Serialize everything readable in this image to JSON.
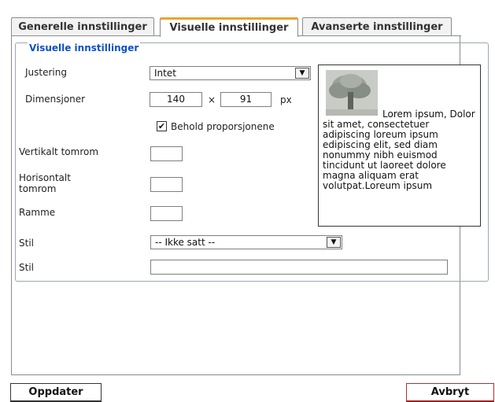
{
  "tabs": [
    {
      "label": "Generelle innstillinger",
      "active": false
    },
    {
      "label": "Visuelle innstillinger",
      "active": true
    },
    {
      "label": "Avanserte innstillinger",
      "active": false
    }
  ],
  "fieldset": {
    "legend": "Visuelle innstillinger"
  },
  "form": {
    "alignment_label": "Justering",
    "alignment_value": "Intet",
    "dimensions_label": "Dimensjoner",
    "width_value": "140",
    "times_sign": "×",
    "height_value": "91",
    "unit": "px",
    "keep_proportions_label": "Behold proporsjonene",
    "keep_proportions_checked": true,
    "vspace_label": "Vertikalt tomrom",
    "hspace_label_line1": "Horisontalt",
    "hspace_label_line2": "tomrom",
    "border_label": "Ramme",
    "style_select_label": "Stil",
    "style_select_value": "-- Ikke satt --",
    "style_text_label": "Stil",
    "style_text_value": ""
  },
  "preview": {
    "text": "Lorem ipsum, Dolor sit amet, consectetuer adipiscing loreum ipsum edipiscing elit, sed diam nonummy nibh euismod tincidunt ut laoreet dolore magna aliquam erat volutpat.Loreum ipsum"
  },
  "buttons": {
    "update": "Oppdater",
    "cancel": "Avbryt"
  },
  "icons": {
    "dropdown": "chevron-down-icon",
    "check": "checkmark-icon",
    "preview_image": "tree-image"
  },
  "colors": {
    "active_tab_accent": "#f0a030",
    "legend": "#1050c8",
    "cancel_border": "#b03030"
  }
}
